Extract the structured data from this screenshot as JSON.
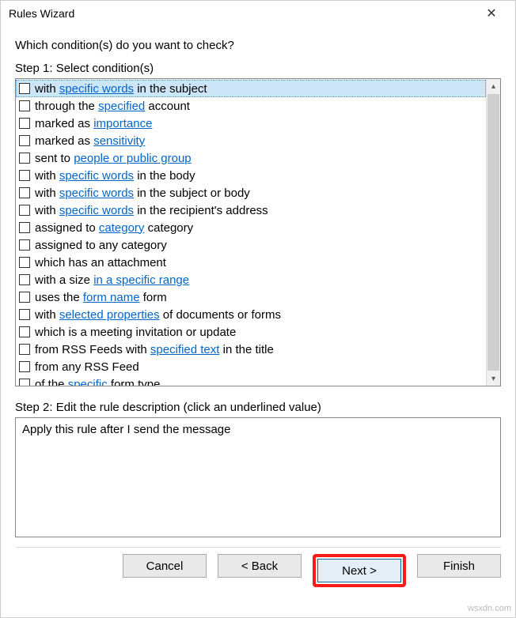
{
  "window": {
    "title": "Rules Wizard"
  },
  "question": "Which condition(s) do you want to check?",
  "step1_label": "Step 1: Select condition(s)",
  "conditions": [
    {
      "pre": "with ",
      "link": "specific words",
      "post": " in the subject",
      "selected": true
    },
    {
      "pre": "through the ",
      "link": "specified",
      "post": " account"
    },
    {
      "pre": "marked as ",
      "link": "importance",
      "post": ""
    },
    {
      "pre": "marked as ",
      "link": "sensitivity",
      "post": ""
    },
    {
      "pre": "sent to ",
      "link": "people or public group",
      "post": ""
    },
    {
      "pre": "with ",
      "link": "specific words",
      "post": " in the body"
    },
    {
      "pre": "with ",
      "link": "specific words",
      "post": " in the subject or body"
    },
    {
      "pre": "with ",
      "link": "specific words",
      "post": " in the recipient's address"
    },
    {
      "pre": "assigned to ",
      "link": "category",
      "post": " category"
    },
    {
      "pre": "assigned to any category",
      "link": "",
      "post": ""
    },
    {
      "pre": "which has an attachment",
      "link": "",
      "post": ""
    },
    {
      "pre": "with a size ",
      "link": "in a specific range",
      "post": ""
    },
    {
      "pre": "uses the ",
      "link": "form name",
      "post": " form"
    },
    {
      "pre": "with ",
      "link": "selected properties",
      "post": " of documents or forms"
    },
    {
      "pre": "which is a meeting invitation or update",
      "link": "",
      "post": ""
    },
    {
      "pre": "from RSS Feeds with ",
      "link": "specified text",
      "post": " in the title"
    },
    {
      "pre": "from any RSS Feed",
      "link": "",
      "post": ""
    },
    {
      "pre": "of the ",
      "link": "specific",
      "post": " form type"
    }
  ],
  "step2_label": "Step 2: Edit the rule description (click an underlined value)",
  "description": "Apply this rule after I send the message",
  "buttons": {
    "cancel": "Cancel",
    "back": "< Back",
    "next": "Next >",
    "finish": "Finish"
  },
  "watermark": "wsxdn.com"
}
